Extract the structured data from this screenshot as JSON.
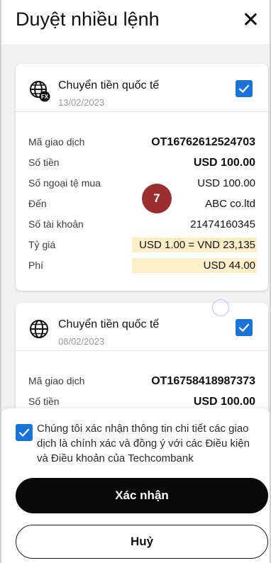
{
  "header": {
    "title": "Duyệt nhiều lệnh"
  },
  "cards": [
    {
      "icon": "globe-fx-icon",
      "title": "Chuyển tiền quốc tế",
      "date": "13/02/2023",
      "checked": true,
      "rows": [
        {
          "label": "Mã giao dịch",
          "value": "OT16762612524703"
        },
        {
          "label": "Số tiền",
          "value": "USD 100.00"
        },
        {
          "label": "Số ngoại tệ mua",
          "value": "USD 100.00"
        },
        {
          "label": "Đến",
          "value": "ABC co.ltd"
        },
        {
          "label": "Số tài khoản",
          "value": "21474160345"
        },
        {
          "label": "Tỷ giá",
          "value": "USD 1.00 = VND 23,135"
        },
        {
          "label": "Phí",
          "value": "USD 44.00"
        }
      ]
    },
    {
      "icon": "globe-icon",
      "title": "Chuyển tiền quốc tế",
      "date": "08/02/2023",
      "checked": true,
      "rows": [
        {
          "label": "Mã giao dịch",
          "value": "OT16758418987373"
        },
        {
          "label": "Số tiền",
          "value": "USD 100.00"
        }
      ]
    }
  ],
  "annotation": {
    "step": "7"
  },
  "footer": {
    "agree_checked": true,
    "agree_text": "Chúng tôi xác nhận thông tin chi tiết các giao dịch là chính xác và đồng ý với các Điều kiện và Điều khoản của Techcombank",
    "confirm_label": "Xác nhận",
    "cancel_label": "Huỷ"
  },
  "colors": {
    "accent": "#1a73d9",
    "highlight": "#fdf0c8",
    "badge": "#9b2f2f",
    "primary_button": "#0a0a0a"
  }
}
